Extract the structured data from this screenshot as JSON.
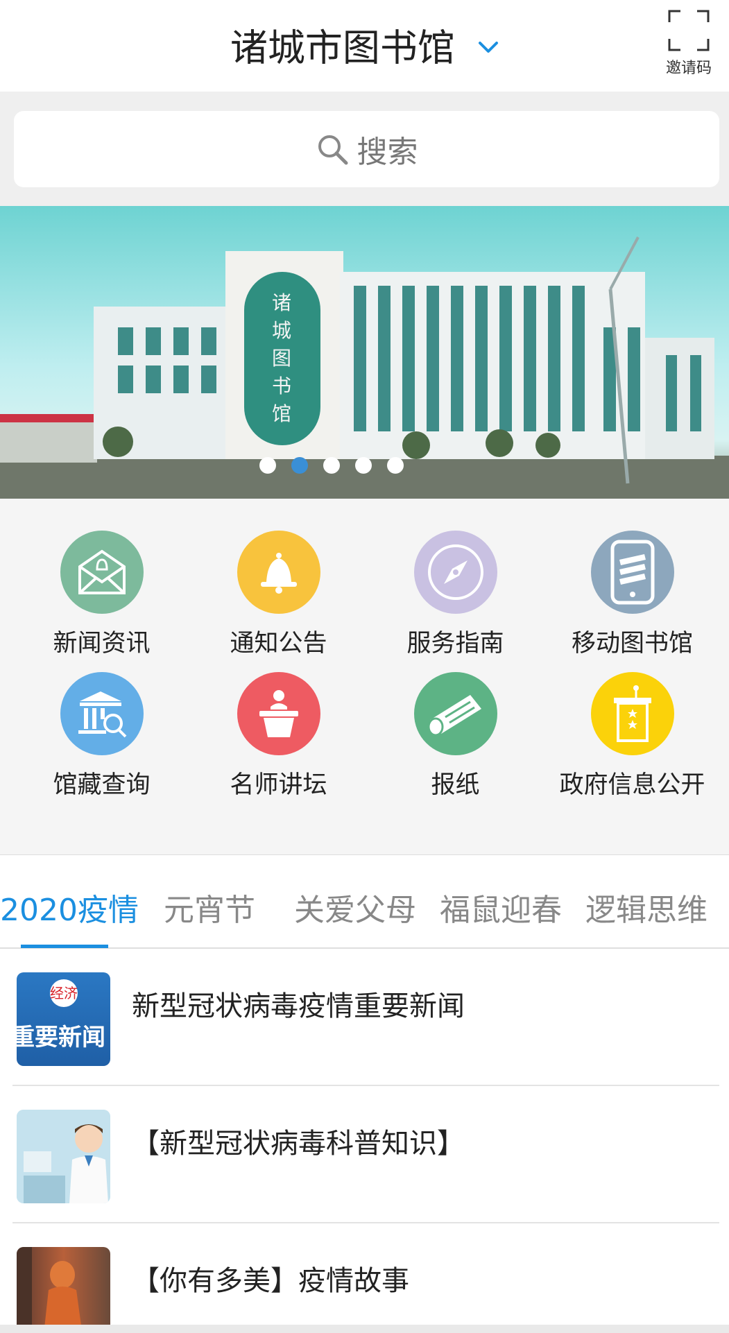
{
  "header": {
    "title": "诸城市图书馆",
    "invite_label": "邀请码"
  },
  "search": {
    "placeholder": "搜索"
  },
  "banner": {
    "image_text": "诸城图书馆",
    "page_count": 5,
    "active_index": 1
  },
  "menu": {
    "items": [
      {
        "label": "新闻资讯",
        "icon": "envelope-bell-icon",
        "color": "#7dba9c"
      },
      {
        "label": "通知公告",
        "icon": "bell-icon",
        "color": "#f8c33d"
      },
      {
        "label": "服务指南",
        "icon": "compass-icon",
        "color": "#c9c1e2"
      },
      {
        "label": "移动图书馆",
        "icon": "mobile-books-icon",
        "color": "#8da7bd"
      },
      {
        "label": "馆藏查询",
        "icon": "library-search-icon",
        "color": "#63aee7"
      },
      {
        "label": "名师讲坛",
        "icon": "lecturer-podium-icon",
        "color": "#ee5b62"
      },
      {
        "label": "报纸",
        "icon": "newspaper-icon",
        "color": "#5db385"
      },
      {
        "label": "政府信息公开",
        "icon": "government-podium-icon",
        "color": "#fbd20a"
      }
    ]
  },
  "tabs": {
    "items": [
      "2020疫情",
      "元宵节",
      "关爱父母",
      "福鼠迎春",
      "逻辑思维"
    ],
    "active_index": 0
  },
  "articles": [
    {
      "title": "新型冠状病毒疫情重要新闻",
      "thumb_text": "重要新闻",
      "thumb_logo": "经济"
    },
    {
      "title": "【新型冠状病毒科普知识】"
    },
    {
      "title": "【你有多美】疫情故事"
    }
  ],
  "colors": {
    "accent": "#1b8fe0",
    "active_dot": "#3a8fd6"
  }
}
